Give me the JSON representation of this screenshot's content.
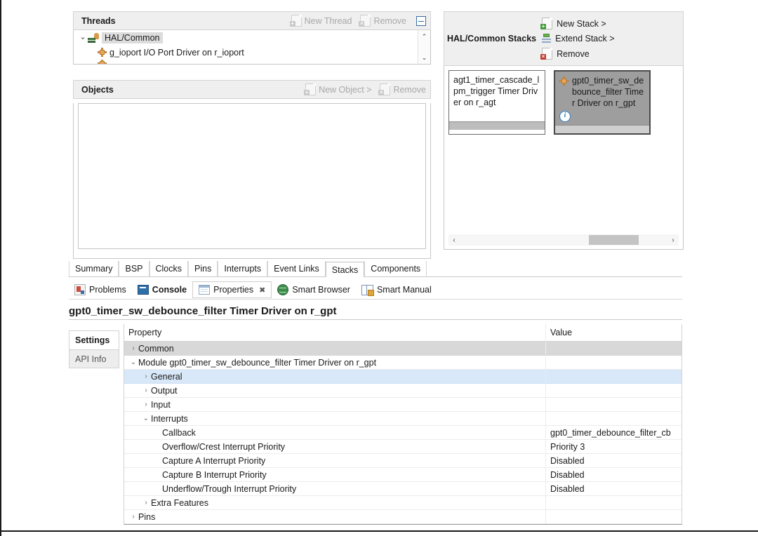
{
  "threads": {
    "title": "Threads",
    "toolbar": [
      {
        "label": "New Thread",
        "icon": "new-thread-icon",
        "enabled": false
      },
      {
        "label": "Remove",
        "icon": "remove-thread-icon",
        "enabled": false
      }
    ],
    "collapse_all_icon": "collapse-all-icon",
    "tree": [
      {
        "label": "HAL/Common",
        "expander": "⌄",
        "icon": "hal-common-icon",
        "indent": 0,
        "selected": true
      },
      {
        "label": "g_ioport I/O Port Driver on r_ioport",
        "expander": "",
        "icon": "module-puzzle-icon",
        "indent": 1,
        "selected": false
      }
    ],
    "scroll_up": "⌃",
    "scroll_down": "⌄"
  },
  "objects": {
    "title": "Objects",
    "toolbar": [
      {
        "label": "New Object >",
        "icon": "new-object-icon",
        "enabled": false
      },
      {
        "label": "Remove",
        "icon": "remove-object-icon",
        "enabled": false
      }
    ]
  },
  "stacks": {
    "header_label": "HAL/Common Stacks",
    "actions": [
      {
        "label": "New Stack >",
        "icon": "new-stack-icon"
      },
      {
        "label": "Extend Stack >",
        "icon": "extend-stack-icon"
      },
      {
        "label": "Remove",
        "icon": "remove-stack-icon"
      }
    ],
    "cards": [
      {
        "title": "agt1_timer_cascade_lpm_trigger Timer Driver on r_agt",
        "selected": false,
        "has_icon": false,
        "has_info": false
      },
      {
        "title": "gpt0_timer_sw_debounce_filter Timer Driver on r_gpt",
        "selected": true,
        "has_icon": true,
        "icon": "module-puzzle-icon",
        "has_info": true,
        "info_glyph": "i"
      }
    ],
    "scroll_left": "‹",
    "scroll_right": "›"
  },
  "config_tabs": [
    {
      "label": "Summary",
      "active": false
    },
    {
      "label": "BSP",
      "active": false
    },
    {
      "label": "Clocks",
      "active": false
    },
    {
      "label": "Pins",
      "active": false
    },
    {
      "label": "Interrupts",
      "active": false
    },
    {
      "label": "Event Links",
      "active": false
    },
    {
      "label": "Stacks",
      "active": true
    },
    {
      "label": "Components",
      "active": false
    }
  ],
  "view_tabs": [
    {
      "label": "Problems",
      "icon": "problems-icon",
      "active": false,
      "bold": false,
      "closable": false
    },
    {
      "label": "Console",
      "icon": "console-icon",
      "active": false,
      "bold": true,
      "closable": false
    },
    {
      "label": "Properties",
      "icon": "properties-icon",
      "active": true,
      "bold": false,
      "closable": true,
      "close_glyph": "✖"
    },
    {
      "label": "Smart Browser",
      "icon": "smart-browser-icon",
      "active": false,
      "bold": false,
      "closable": false
    },
    {
      "label": "Smart Manual",
      "icon": "smart-manual-icon",
      "active": false,
      "bold": false,
      "closable": false
    }
  ],
  "properties": {
    "title": "gpt0_timer_sw_debounce_filter Timer Driver on r_gpt",
    "side_tabs": [
      {
        "label": "Settings",
        "active": true
      },
      {
        "label": "API Info",
        "active": false
      }
    ],
    "columns": {
      "property": "Property",
      "value": "Value"
    },
    "rows": [
      {
        "name": "Common",
        "value": "",
        "indent": 0,
        "expander": "›",
        "style": "grey"
      },
      {
        "name": "Module gpt0_timer_sw_debounce_filter Timer Driver on r_gpt",
        "value": "",
        "indent": 0,
        "expander": "⌄",
        "style": "plain"
      },
      {
        "name": "General",
        "value": "",
        "indent": 1,
        "expander": "›",
        "style": "blue"
      },
      {
        "name": "Output",
        "value": "",
        "indent": 1,
        "expander": "›",
        "style": "plain"
      },
      {
        "name": "Input",
        "value": "",
        "indent": 1,
        "expander": "›",
        "style": "plain"
      },
      {
        "name": "Interrupts",
        "value": "",
        "indent": 1,
        "expander": "⌄",
        "style": "plain"
      },
      {
        "name": "Callback",
        "value": "gpt0_timer_debounce_filter_cb",
        "indent": 2,
        "expander": "",
        "style": "plain"
      },
      {
        "name": "Overflow/Crest Interrupt Priority",
        "value": "Priority 3",
        "indent": 2,
        "expander": "",
        "style": "plain"
      },
      {
        "name": "Capture A Interrupt Priority",
        "value": "Disabled",
        "indent": 2,
        "expander": "",
        "style": "plain"
      },
      {
        "name": "Capture B Interrupt Priority",
        "value": "Disabled",
        "indent": 2,
        "expander": "",
        "style": "plain"
      },
      {
        "name": "Underflow/Trough Interrupt Priority",
        "value": "Disabled",
        "indent": 2,
        "expander": "",
        "style": "plain"
      },
      {
        "name": "Extra Features",
        "value": "",
        "indent": 1,
        "expander": "›",
        "style": "plain"
      },
      {
        "name": "Pins",
        "value": "",
        "indent": 0,
        "expander": "›",
        "style": "plain"
      }
    ]
  }
}
